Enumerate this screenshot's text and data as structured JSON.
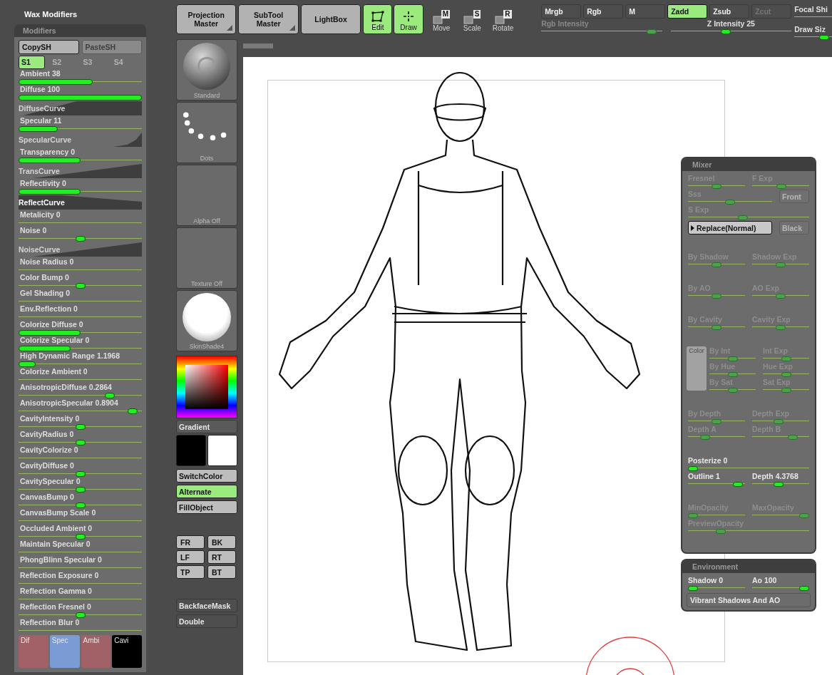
{
  "left_panel": {
    "title": "Wax Modifiers",
    "header": "Modifiers",
    "copy_buttons": [
      {
        "label": "CopySH",
        "disabled": false
      },
      {
        "label": "PasteSH",
        "disabled": true
      }
    ],
    "slots": [
      {
        "label": "S1",
        "selected": true
      },
      {
        "label": "S2",
        "selected": false
      },
      {
        "label": "S3",
        "selected": false
      },
      {
        "label": "S4",
        "selected": false
      }
    ],
    "rows": [
      {
        "kind": "bar",
        "label": "Ambient",
        "value": "38",
        "level": 0.6
      },
      {
        "kind": "bar",
        "label": "Diffuse",
        "value": "100",
        "level": 1
      },
      {
        "kind": "steep",
        "label": "DiffuseCurve"
      },
      {
        "kind": "bar",
        "label": "Specular",
        "value": "11",
        "level": 0.32
      },
      {
        "kind": "knee",
        "label": "SpecularCurve"
      },
      {
        "kind": "bar",
        "label": "Transparency",
        "value": "0",
        "level": 0.5
      },
      {
        "kind": "ramp",
        "label": "TransCurve"
      },
      {
        "kind": "bar",
        "label": "Reflectivity",
        "value": "0",
        "level": 0.5
      },
      {
        "kind": "block",
        "label": "ReflectCurve"
      },
      {
        "kind": "line",
        "label": "Metalicity",
        "value": "0"
      },
      {
        "kind": "knob",
        "label": "Noise",
        "value": "0",
        "level": 0.5
      },
      {
        "kind": "ramp",
        "label": "NoiseCurve"
      },
      {
        "kind": "line",
        "label": "Noise Radius",
        "value": "0"
      },
      {
        "kind": "knob",
        "label": "Color Bump",
        "value": "0",
        "level": 0.5
      },
      {
        "kind": "line",
        "label": "Gel Shading",
        "value": "0"
      },
      {
        "kind": "line",
        "label": "Env.Reflection",
        "value": "0"
      },
      {
        "kind": "bar",
        "label": "Colorize Diffuse",
        "value": "0",
        "level": 0.5
      },
      {
        "kind": "bar",
        "label": "Colorize Specular",
        "value": "0",
        "level": 0.42
      },
      {
        "kind": "bar",
        "label": "High Dynamic Range",
        "value": "1.1968",
        "level": 0.14
      },
      {
        "kind": "line",
        "label": "Colorize Ambient",
        "value": "0"
      },
      {
        "kind": "knob",
        "label": "AnisotropicDiffuse",
        "value": "0.2864",
        "level": 0.76
      },
      {
        "kind": "knob",
        "label": "AnisotropicSpecular",
        "value": "0.8904",
        "level": 0.96
      },
      {
        "kind": "knob",
        "label": "CavityIntensity",
        "value": "0",
        "level": 0.5
      },
      {
        "kind": "knob",
        "label": "CavityRadius",
        "value": "0",
        "level": 0.5
      },
      {
        "kind": "line",
        "label": "CavityColorize",
        "value": "0"
      },
      {
        "kind": "knob",
        "label": "CavityDiffuse",
        "value": "0",
        "level": 0.5
      },
      {
        "kind": "knob",
        "label": "CavitySpecular",
        "value": "0",
        "level": 0.5
      },
      {
        "kind": "knob",
        "label": "CanvasBump",
        "value": "0",
        "level": 0.5
      },
      {
        "kind": "line",
        "label": "CanvasBump Scale",
        "value": "0"
      },
      {
        "kind": "knob",
        "label": "Occluded Ambient",
        "value": "0",
        "level": 0.5
      },
      {
        "kind": "line",
        "label": "Maintain Specular",
        "value": "0"
      },
      {
        "kind": "line",
        "label": "PhongBlinn Specular",
        "value": "0"
      },
      {
        "kind": "line",
        "label": "Reflection Exposure",
        "value": "0"
      },
      {
        "kind": "line",
        "label": "Reflection Gamma",
        "value": "0"
      },
      {
        "kind": "knob",
        "label": "Reflection Fresnel",
        "value": "0",
        "level": 0.5
      },
      {
        "kind": "line",
        "label": "Reflection Blur",
        "value": "0"
      }
    ],
    "channels": [
      {
        "label": "Dif",
        "color": "#a26166"
      },
      {
        "label": "Spec",
        "color": "#7a9bd4"
      },
      {
        "label": "Ambi",
        "color": "#a26166"
      },
      {
        "label": "Cavi",
        "color": "#000000"
      }
    ]
  },
  "toolbar": {
    "buttons": [
      {
        "label": "Projection Master",
        "kind": "menu"
      },
      {
        "label": "SubTool Master",
        "kind": "menu"
      },
      {
        "label": "LightBox",
        "kind": "plain"
      }
    ],
    "modes": [
      {
        "label": "Edit",
        "kind": "edit",
        "selected": true
      },
      {
        "label": "Draw",
        "kind": "draw",
        "selected": true
      }
    ],
    "transforms": [
      {
        "label": "Move",
        "key": "M"
      },
      {
        "label": "Scale",
        "key": "S"
      },
      {
        "label": "Rotate",
        "key": "R"
      }
    ],
    "draw_modes": [
      {
        "label": "Mrgb",
        "selected": false,
        "disabled": false
      },
      {
        "label": "Rgb",
        "selected": false,
        "disabled": false
      },
      {
        "label": "M",
        "selected": false,
        "disabled": false
      },
      {
        "label": "Zadd",
        "selected": true,
        "disabled": false
      },
      {
        "label": "Zsub",
        "selected": false,
        "disabled": false
      },
      {
        "label": "Zcut",
        "selected": false,
        "disabled": true
      }
    ],
    "sliders": [
      {
        "kind": "knob",
        "label": "Rgb Intensity",
        "disabled": true,
        "level": 0.95
      },
      {
        "kind": "knob",
        "label": "Z Intensity",
        "value": "25",
        "disabled": false,
        "level": 0.45
      }
    ],
    "side_sliders": [
      {
        "kind": "line",
        "label": "Focal Shi",
        "disabled": false
      },
      {
        "kind": "knob",
        "label": "Draw Siz",
        "disabled": false,
        "level": 0.9
      }
    ]
  },
  "tray": {
    "tiles": [
      {
        "label": "Standard",
        "kind": "material"
      },
      {
        "label": "Dots",
        "kind": "dots"
      },
      {
        "label": "Alpha Off",
        "kind": "empty"
      },
      {
        "label": "Texture Off",
        "kind": "empty"
      },
      {
        "label": "SkinShade4",
        "kind": "shade"
      }
    ],
    "gradient": "Gradient",
    "swatches": [
      {
        "color": "#000000"
      },
      {
        "color": "#ffffff"
      }
    ],
    "color_buttons": [
      {
        "label": "SwitchColor",
        "on": false
      },
      {
        "label": "Alternate",
        "on": true
      },
      {
        "label": "FillObject",
        "on": false
      }
    ],
    "views": [
      "FR",
      "BK",
      "LF",
      "RT",
      "TP",
      "BT"
    ],
    "bottom_buttons": [
      {
        "label": "BackfaceMask",
        "on": false
      },
      {
        "label": "Double",
        "on": false
      }
    ]
  },
  "mixer": {
    "title": "Mixer",
    "sections": [
      {
        "rows": [
          [
            {
              "kind": "slider",
              "label": "Fresnel",
              "level": 0.5,
              "disabled": true
            },
            {
              "kind": "slider",
              "label": "F Exp",
              "level": 0.52,
              "disabled": true
            }
          ],
          [
            {
              "kind": "slider",
              "label": "Sss",
              "level": 0.5,
              "disabled": true
            },
            {
              "kind": "button",
              "label": "Front",
              "disabled": true
            }
          ],
          [
            {
              "kind": "slider",
              "label": "S Exp",
              "level": 0.45,
              "disabled": true
            }
          ],
          [
            {
              "kind": "dropdown",
              "label": "Replace(Normal)",
              "disabled": false
            },
            {
              "kind": "button",
              "label": "Black",
              "disabled": true
            }
          ]
        ]
      },
      {
        "rows": [
          [
            {
              "kind": "slider",
              "label": "By Shadow",
              "level": 0.5,
              "disabled": true
            },
            {
              "kind": "slider",
              "label": "Shadow Exp",
              "level": 0.5,
              "disabled": true
            }
          ]
        ]
      },
      {
        "rows": [
          [
            {
              "kind": "slider",
              "label": "By AO",
              "level": 0.5,
              "disabled": true
            },
            {
              "kind": "slider",
              "label": "AO Exp",
              "level": 0.5,
              "disabled": true
            }
          ]
        ]
      },
      {
        "rows": [
          [
            {
              "kind": "slider",
              "label": "By Cavity",
              "level": 0.5,
              "disabled": true
            },
            {
              "kind": "slider",
              "label": "Cavity Exp",
              "level": 0.5,
              "disabled": true
            }
          ]
        ]
      },
      {
        "swatch": "Color",
        "rows": [
          [
            {
              "kind": "slider",
              "label": "By Int",
              "level": 0.5,
              "disabled": true
            },
            {
              "kind": "slider",
              "label": "Int Exp",
              "level": 0.5,
              "disabled": true
            }
          ],
          [
            {
              "kind": "slider",
              "label": "By Hue",
              "level": 0.5,
              "disabled": true
            },
            {
              "kind": "slider",
              "label": "Hue Exp",
              "level": 0.5,
              "disabled": true
            }
          ],
          [
            {
              "kind": "slider",
              "label": "By Sat",
              "level": 0.5,
              "disabled": true
            },
            {
              "kind": "slider",
              "label": "Sat Exp",
              "level": 0.5,
              "disabled": true
            }
          ]
        ]
      },
      {
        "rows": [
          [
            {
              "kind": "slider",
              "label": "By Depth",
              "level": 0.5,
              "disabled": true
            },
            {
              "kind": "slider",
              "label": "Depth Exp",
              "level": 0.45,
              "disabled": true
            }
          ],
          [
            {
              "kind": "slider",
              "label": "Depth A",
              "level": 0.25,
              "disabled": true
            },
            {
              "kind": "slider",
              "label": "Depth B",
              "level": 0.75,
              "disabled": true
            }
          ]
        ]
      },
      {
        "rows": [
          [
            {
              "kind": "slider",
              "label": "Posterize",
              "value": "0",
              "level": 0,
              "disabled": false
            }
          ],
          [
            {
              "kind": "slider",
              "label": "Outline",
              "value": "1",
              "level": 0.95,
              "disabled": false
            },
            {
              "kind": "slider",
              "label": "Depth",
              "value": "4.3768",
              "level": 0.45,
              "disabled": false
            }
          ]
        ]
      },
      {
        "rows": [
          [
            {
              "kind": "slider",
              "label": "MinOpacity",
              "level": 0,
              "disabled": true
            },
            {
              "kind": "slider",
              "label": "MaxOpacity",
              "level": 1,
              "disabled": true
            }
          ],
          [
            {
              "kind": "slider",
              "label": "PreviewOpacity",
              "level": 0.25,
              "disabled": true
            }
          ]
        ]
      }
    ]
  },
  "environment": {
    "title": "Environment",
    "sliders": [
      {
        "label": "Shadow",
        "value": "0",
        "level": 0
      },
      {
        "label": "Ao",
        "value": "100",
        "level": 1
      }
    ],
    "button": "Vibrant Shadows And AO"
  }
}
